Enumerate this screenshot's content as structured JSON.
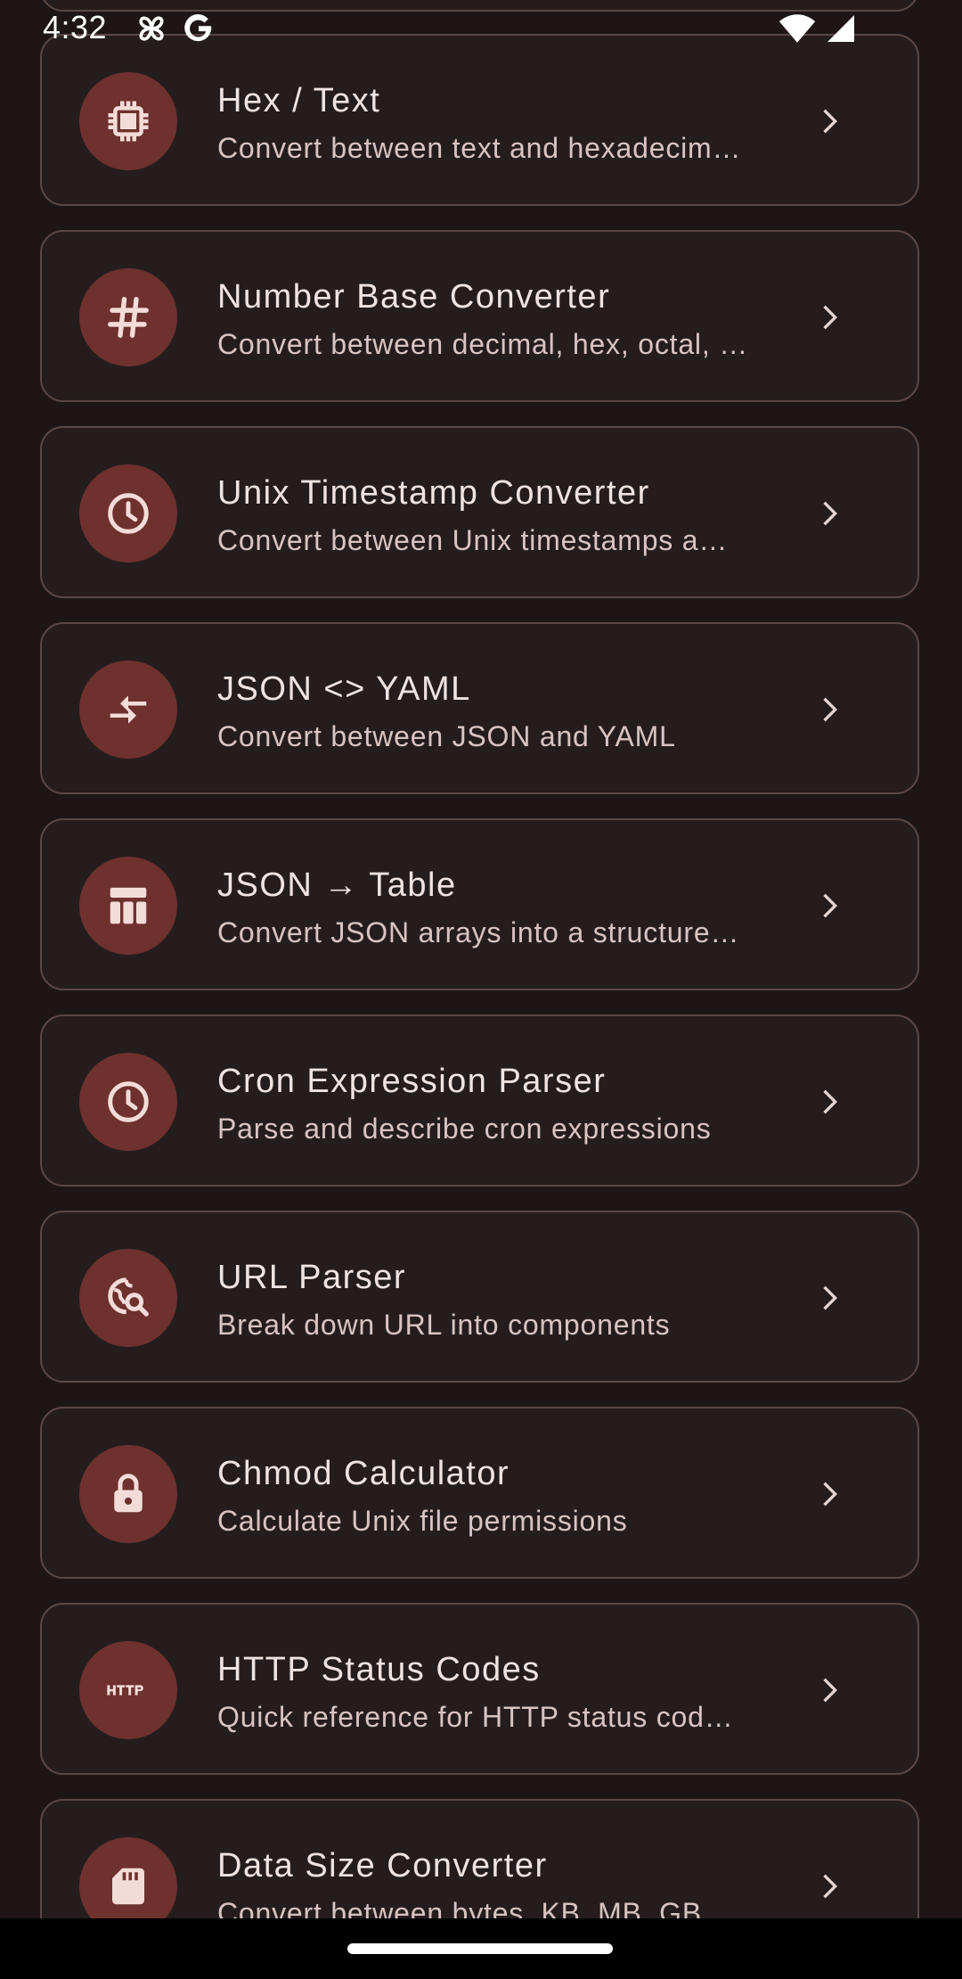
{
  "status_bar": {
    "time": "4:32",
    "left_icons": [
      "pinwheel-icon",
      "google-icon"
    ],
    "right_icons": [
      "wifi-icon",
      "cellular-signal-icon"
    ]
  },
  "colors": {
    "background": "#1e1616",
    "card": "#251d1d",
    "card_border": "#5a4846",
    "icon_circle": "#6e312d",
    "text_primary": "#f0e3e1",
    "text_secondary": "#d8c4c1"
  },
  "tools": [
    {
      "title": "Hex / Text",
      "description": "Convert between text and hexadecim…",
      "icon": "chip-icon"
    },
    {
      "title": "Number Base Converter",
      "description": "Convert between decimal, hex, octal, …",
      "icon": "hash-icon"
    },
    {
      "title": "Unix Timestamp Converter",
      "description": "Convert between Unix timestamps a…",
      "icon": "clock-icon"
    },
    {
      "title": "JSON <> YAML",
      "description": "Convert between JSON and YAML",
      "icon": "compare-arrows-icon"
    },
    {
      "title": "JSON → Table",
      "description": "Convert JSON arrays into a structure…",
      "icon": "table-icon"
    },
    {
      "title": "Cron Expression Parser",
      "description": "Parse and describe cron expressions",
      "icon": "clock-icon"
    },
    {
      "title": "URL Parser",
      "description": "Break down URL into components",
      "icon": "travel-explore-icon"
    },
    {
      "title": "Chmod Calculator",
      "description": "Calculate Unix file permissions",
      "icon": "lock-icon"
    },
    {
      "title": "HTTP Status Codes",
      "description": "Quick reference for HTTP status cod…",
      "icon": "http-icon"
    },
    {
      "title": "Data Size Converter",
      "description": "Convert between bytes, KB, MB, GB…",
      "icon": "sd-card-icon"
    }
  ]
}
